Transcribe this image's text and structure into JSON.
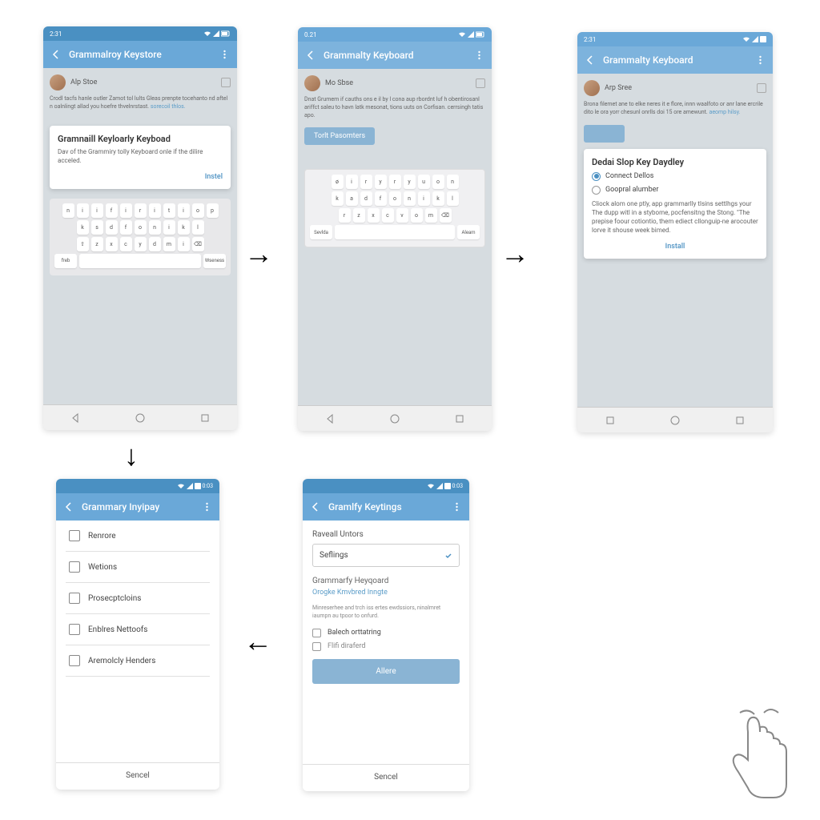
{
  "phone1": {
    "time": "2:31",
    "title": "Grammalroy Keystore",
    "user": "Alp Stoe",
    "body": "Crodl tacfs hanle outler Zamot tol lults Gleas prenpte tocehanto nd aftel n oalnlingt allad you hoefre thvelnrstast.",
    "body_link": "sorecoil thlos.",
    "card_title": "Gramnaill Keyloarly Keyboad",
    "card_text": "Dav of the Grammiry tolly Keyboard onle if the dilire acceled.",
    "card_btn": "Instel",
    "kb_row1": [
      "n",
      "i",
      "i",
      "f",
      "i",
      "r",
      "i",
      "t",
      "i",
      "o",
      "p"
    ],
    "kb_row2": [
      "k",
      "s",
      "d",
      "f",
      "o",
      "n",
      "i",
      "k",
      "l"
    ],
    "kb_row3": [
      "⇧",
      "z",
      "x",
      "c",
      "y",
      "d",
      "m",
      "i",
      "⌫"
    ],
    "kb_row4_left": "freb",
    "kb_row4_right": "Wseness"
  },
  "phone2": {
    "time": "0.21",
    "title": "Grammalty Keyboard",
    "user": "Mo Sbse",
    "body": "Dnat Grumem if cauths ons e il by l cona aup rbordnt luf h obentirosanl ariffct saleu to havn latk mesonat, tions uuts on Corfisan. cerrsingh tatis apo.",
    "pill": "Torlt Pasomters",
    "kb_row1": [
      "ø",
      "i",
      "r",
      "y",
      "r",
      "y",
      "u",
      "o",
      "n"
    ],
    "kb_row2": [
      "k",
      "a",
      "d",
      "f",
      "o",
      "n",
      "i",
      "k",
      "l"
    ],
    "kb_row3": [
      "r",
      "z",
      "x",
      "c",
      "v",
      "o",
      "m",
      "⌫"
    ],
    "kb_left": "Sevlda",
    "kb_right": "Aleam"
  },
  "phone3": {
    "time": "2:31",
    "title": "Grammalty Keyboard",
    "user": "Arp Sree",
    "body": "Brona filemet ane to elke neres it e flore, innn waalfoto or anr lane ercrile dito le ora yorr chesunl onrlls doi 15 ore amewunt.",
    "body_link": "aeomp hilsy.",
    "card_title": "Dedai Slop Key Daydley",
    "radio1": "Connect Dellos",
    "radio2": "Goopral alumber",
    "card_text": "Cliock alom one ptly, app grammarlly tlsins settlhgs your The dupp witl in a stybome, pocfensitng the Stong. \"The prepise foour cotiontio, them ediect cllonguip-ne arocouter lorve it shouse week bimed.",
    "card_btn": "Install"
  },
  "phone4": {
    "title": "Grammary Inyipay",
    "items": [
      "Renrore",
      "Wetions",
      "Prosecptcloins",
      "Enblres Nettoofs",
      "Aremolcly Henders"
    ],
    "bottom": "Sencel"
  },
  "phone5": {
    "title": "Gramlfy Keytings",
    "section": "Raveall Untors",
    "select": "Seflings",
    "sub": "Grammarfy Heyqoard",
    "link": "Orogke Kmvbred Inngte",
    "small": "Minreserhee and trch iss ertes ewdssiors, ninalmret iaumpn au tpoor to onfurd.",
    "check1": "Balech orttatring",
    "check2": "Flifi diraferd",
    "primary": "Allere",
    "bottom": "Sencel"
  }
}
